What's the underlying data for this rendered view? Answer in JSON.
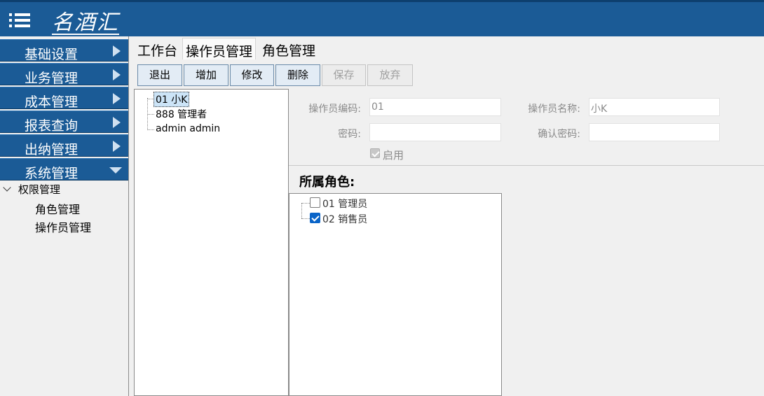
{
  "app": {
    "logo": "名酒汇"
  },
  "sidebar": {
    "items": [
      {
        "label": "基础设置",
        "expanded": false
      },
      {
        "label": "业务管理",
        "expanded": false
      },
      {
        "label": "成本管理",
        "expanded": false
      },
      {
        "label": "报表查询",
        "expanded": false
      },
      {
        "label": "出纳管理",
        "expanded": false
      },
      {
        "label": "系统管理",
        "expanded": true
      }
    ],
    "tree": {
      "group": "权限管理",
      "children": [
        "角色管理",
        "操作员管理"
      ]
    }
  },
  "tabs": [
    {
      "label": "工作台",
      "active": false
    },
    {
      "label": "操作员管理",
      "active": true
    },
    {
      "label": "角色管理",
      "active": false
    }
  ],
  "toolbar": {
    "exit": "退出",
    "add": "增加",
    "edit": "修改",
    "delete": "删除",
    "save": "保存",
    "discard": "放弃"
  },
  "operators": {
    "items": [
      "01 小K",
      "888 管理者",
      "admin admin"
    ],
    "selected_index": 0
  },
  "form": {
    "code_label": "操作员编码:",
    "code_value": "01",
    "name_label": "操作员名称:",
    "name_value": "小K",
    "password_label": "密码:",
    "password_value": "",
    "confirm_label": "确认密码:",
    "confirm_value": "",
    "enabled_label": "启用",
    "enabled": true
  },
  "roles": {
    "title": "所属角色:",
    "items": [
      {
        "label": "01 管理员",
        "checked": false
      },
      {
        "label": "02 销售员",
        "checked": true
      }
    ]
  },
  "colors": {
    "brand": "#1b5b96",
    "checkbox_on": "#0a64c8"
  }
}
